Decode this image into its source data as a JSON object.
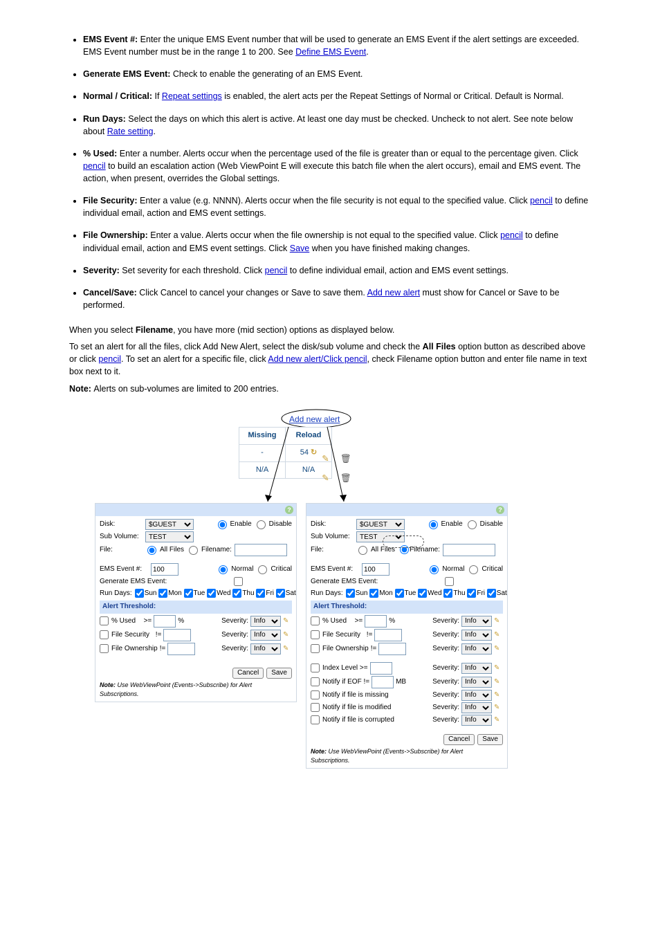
{
  "bullets": [
    {
      "pre": "",
      "bold": "EMS Event #: ",
      "text": "Enter the unique EMS Event number that will be used to generate an EMS Event if the alert settings are exceeded. EMS Event number must be in the range 1 to 200. See ",
      "link": "Define EMS Event",
      "post": "."
    },
    {
      "bold": "Generate EMS Event: ",
      "text": "Check to enable the generating of an EMS Event."
    },
    {
      "bold": "Normal / Critical: ",
      "text": "If ",
      "link": "Repeat settings",
      "post": " is enabled, the alert acts per the Repeat Settings of Normal or Critical. Default is Normal."
    },
    {
      "bold": "Run Days: ",
      "text": "Select the days on which this alert is active. At least one day must be checked. Uncheck to not alert. See note below about ",
      "link": "Rate setting",
      "post": "."
    },
    {
      "bold": "% Used: ",
      "text": "Enter a number. Alerts occur when the percentage used of the file is greater than or equal to the percentage given. Click ",
      "link": "pencil",
      "post": " to build an escalation action (Web ViewPoint E will execute this batch file when the alert occurs), email and EMS event. The action, when present, overrides the Global settings."
    },
    {
      "bold": "File Security: ",
      "text": "Enter a value (e.g. NNNN). Alerts occur when the file security is not equal to the specified value. Click ",
      "link": "pencil",
      "post": " to define individual email, action and EMS event settings."
    },
    {
      "bold": "File Ownership: ",
      "text": "Enter a value. Alerts occur when the file ownership is not equal to the specified value. Click ",
      "link0": "pencil",
      "mid": " to define individual email, action and EMS event settings. Click ",
      "link1": "Save",
      "post": " when you have finished making changes."
    },
    {
      "bold": "Severity: ",
      "text": "Set severity for each threshold. Click ",
      "link": "pencil",
      "post": " to define individual email, action and EMS event settings."
    },
    {
      "bold": "Cancel/Save: ",
      "text": "Click Cancel to cancel your changes or Save to save them. ",
      "link": "Add new alert",
      "post": " must show for Cancel or Save to be performed."
    }
  ],
  "below": {
    "p1a": "When you select ",
    "p1b": "Filename",
    "p1c": ", you have more (mid section) options as displayed below.",
    "p2a": "To set an alert for all the files, click Add New Alert, select the disk/sub volume and check the ",
    "p2b": "All Files",
    "p2c": " option button as described above or click ",
    "p2l1": "pencil",
    "p2d": ". To set an alert for a specific file, click ",
    "p2l2": "Add new alert/Click pencil",
    "p2e": ", check Filename option button and enter file name in text box next to it.",
    "note": "Note: ",
    "noteText": "Alerts on sub-volumes are limited to 200 entries."
  },
  "table": {
    "add": "Add new alert",
    "h1": "Missing",
    "h2": "Reload",
    "r1c1": "-",
    "r1c2": "54",
    "r2c1": "N/A",
    "r2c2": "N/A"
  },
  "form": {
    "disk": "Disk:",
    "diskVal": "$GUEST",
    "subv": "Sub Volume:",
    "subvVal": "TEST",
    "file": "File:",
    "allFiles": "All Files",
    "filename": "Filename:",
    "enable": "Enable",
    "disable": "Disable",
    "ems": "EMS Event #:",
    "emsVal": "100",
    "normal": "Normal",
    "critical": "Critical",
    "gen": "Generate EMS Event:",
    "run": "Run Days:",
    "sun": "Sun",
    "mon": "Mon",
    "tue": "Tue",
    "wed": "Wed",
    "thu": "Thu",
    "fri": "Fri",
    "sat": "Sat",
    "alertThr": "Alert Threshold:",
    "pctUsed": "% Used",
    "ge": ">=",
    "pct": "%",
    "fileSec": "File Security",
    "ne": "!=",
    "fileOwn": "File Ownership",
    "sev": "Severity:",
    "info": "Info",
    "idx": "Index Level >=",
    "eof": "Notify if EOF !=",
    "mb": "MB",
    "miss": "Notify if file is missing",
    "mod": "Notify if file is modified",
    "cor": "Notify if file is corrupted",
    "cancel": "Cancel",
    "save": "Save",
    "foot": "Note:",
    "footText": " Use WebViewPoint (Events->Subscribe) for Alert Subscriptions."
  }
}
